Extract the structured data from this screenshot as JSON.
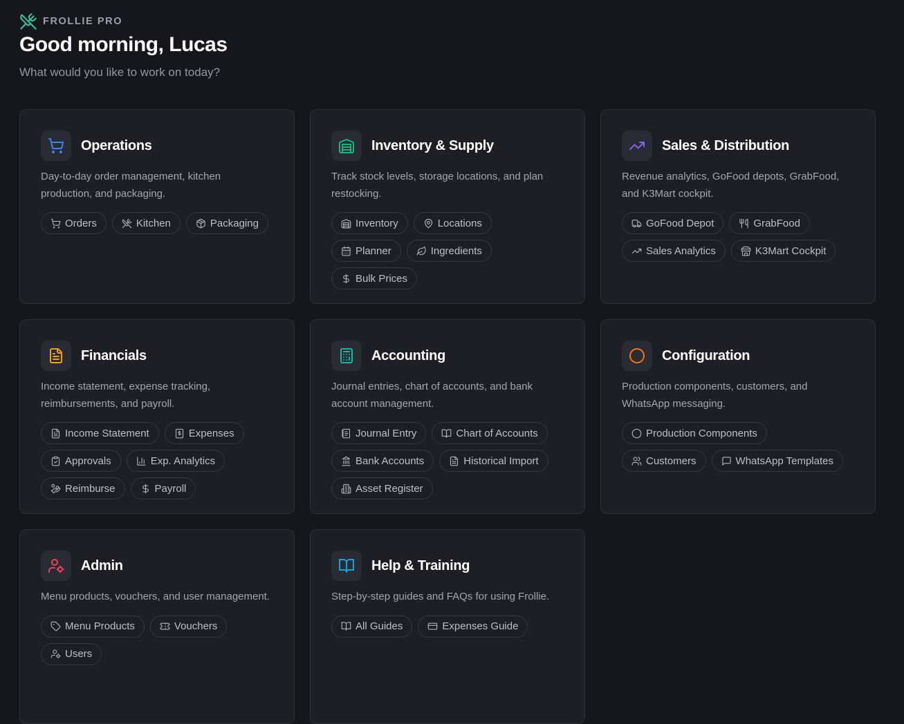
{
  "brand": {
    "name": "FROLLIE PRO",
    "accent": "#2cc8a0"
  },
  "greeting": "Good morning, Lucas",
  "subtitle": "What would you like to work on today?",
  "cards": [
    {
      "title": "Operations",
      "icon": "shopping-cart-icon",
      "color": "#3b82f6",
      "description": "Day-to-day order management, kitchen production, and packaging.",
      "chips": [
        {
          "label": "Orders",
          "icon": "cart-icon"
        },
        {
          "label": "Kitchen",
          "icon": "utensils-crossed-icon"
        },
        {
          "label": "Packaging",
          "icon": "package-icon"
        }
      ]
    },
    {
      "title": "Inventory & Supply",
      "icon": "warehouse-icon",
      "color": "#10b981",
      "description": "Track stock levels, storage locations, and plan restocking.",
      "chips": [
        {
          "label": "Inventory",
          "icon": "warehouse-icon"
        },
        {
          "label": "Locations",
          "icon": "map-pin-icon"
        },
        {
          "label": "Planner",
          "icon": "calendar-icon"
        },
        {
          "label": "Ingredients",
          "icon": "leaf-icon"
        },
        {
          "label": "Bulk Prices",
          "icon": "dollar-icon"
        }
      ]
    },
    {
      "title": "Sales & Distribution",
      "icon": "trending-up-icon",
      "color": "#8b5cf6",
      "description": "Revenue analytics, GoFood depots, GrabFood, and K3Mart cockpit.",
      "chips": [
        {
          "label": "GoFood Depot",
          "icon": "truck-icon"
        },
        {
          "label": "GrabFood",
          "icon": "utensils-icon"
        },
        {
          "label": "Sales Analytics",
          "icon": "trending-up-icon"
        },
        {
          "label": "K3Mart Cockpit",
          "icon": "store-icon"
        }
      ]
    },
    {
      "title": "Financials",
      "icon": "file-text-icon",
      "color": "#f59e0b",
      "description": "Income statement, expense tracking, reimbursements, and payroll.",
      "chips": [
        {
          "label": "Income Statement",
          "icon": "file-text-icon"
        },
        {
          "label": "Expenses",
          "icon": "receipt-icon"
        },
        {
          "label": "Approvals",
          "icon": "clipboard-check-icon"
        },
        {
          "label": "Exp. Analytics",
          "icon": "bar-chart-icon"
        },
        {
          "label": "Reimburse",
          "icon": "hand-coins-icon"
        },
        {
          "label": "Payroll",
          "icon": "dollar-icon"
        }
      ]
    },
    {
      "title": "Accounting",
      "icon": "calculator-icon",
      "color": "#14b8a6",
      "description": "Journal entries, chart of accounts, and bank account management.",
      "chips": [
        {
          "label": "Journal Entry",
          "icon": "notebook-icon"
        },
        {
          "label": "Chart of Accounts",
          "icon": "book-open-icon"
        },
        {
          "label": "Bank Accounts",
          "icon": "landmark-icon"
        },
        {
          "label": "Historical Import",
          "icon": "file-text-icon"
        },
        {
          "label": "Asset Register",
          "icon": "building-icon"
        }
      ]
    },
    {
      "title": "Configuration",
      "icon": "circle-icon",
      "color": "#f97316",
      "description": "Production components, customers, and WhatsApp messaging.",
      "chips": [
        {
          "label": "Production Components",
          "icon": "circle-icon"
        },
        {
          "label": "Customers",
          "icon": "users-icon"
        },
        {
          "label": "WhatsApp Templates",
          "icon": "message-square-icon"
        }
      ]
    },
    {
      "title": "Admin",
      "icon": "user-cog-icon",
      "color": "#f43f5e",
      "description": "Menu products, vouchers, and user management.",
      "chips": [
        {
          "label": "Menu Products",
          "icon": "tag-icon"
        },
        {
          "label": "Vouchers",
          "icon": "ticket-icon"
        },
        {
          "label": "Users",
          "icon": "user-cog-icon"
        }
      ]
    },
    {
      "title": "Help & Training",
      "icon": "book-open-icon",
      "color": "#0ea5e9",
      "description": "Step-by-step guides and FAQs for using Frollie.",
      "chips": [
        {
          "label": "All Guides",
          "icon": "book-open-icon"
        },
        {
          "label": "Expenses Guide",
          "icon": "credit-card-icon"
        }
      ]
    }
  ]
}
